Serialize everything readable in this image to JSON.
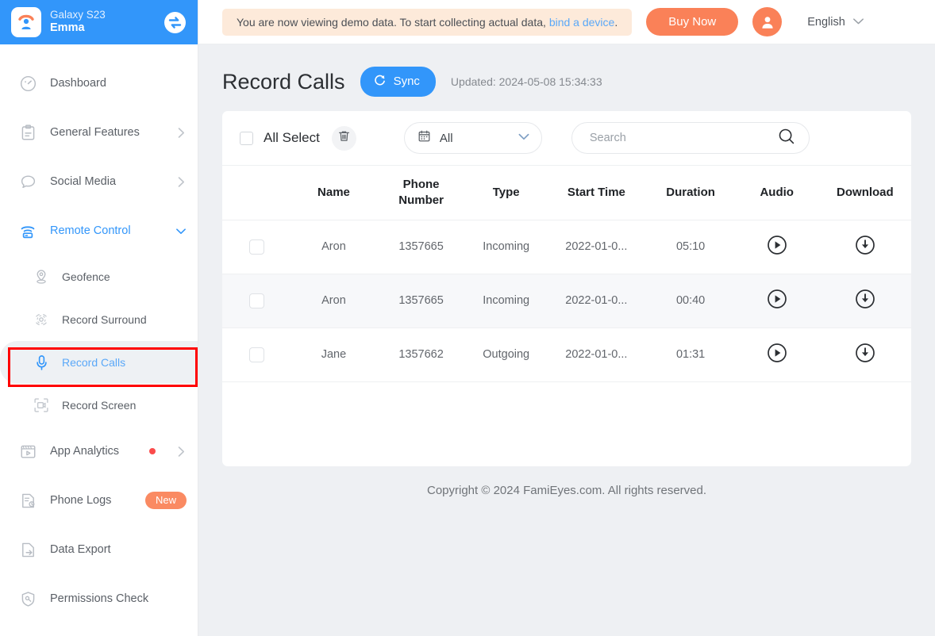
{
  "sidebar": {
    "device": {
      "model": "Galaxy S23",
      "user": "Emma",
      "switch_icon": "swap-device-icon",
      "logo_icon": "famieyes-logo-icon"
    },
    "items": [
      {
        "label": "Dashboard",
        "icon": "dashboard-gauge-icon",
        "level": 0,
        "state": "normal"
      },
      {
        "label": "General Features",
        "icon": "clipboard-icon",
        "level": 0,
        "state": "normal",
        "chevron": "chevron-right"
      },
      {
        "label": "Social Media",
        "icon": "chat-bubble-icon",
        "level": 0,
        "state": "normal",
        "chevron": "chevron-right"
      },
      {
        "label": "Remote Control",
        "icon": "wifi-remote-icon",
        "level": 0,
        "state": "expanded",
        "chevron": "chevron-down"
      },
      {
        "label": "Geofence",
        "icon": "location-pin-icon",
        "level": 1,
        "state": "normal"
      },
      {
        "label": "Record Surround",
        "icon": "surround-audio-icon",
        "level": 1,
        "state": "normal"
      },
      {
        "label": "Record Calls",
        "icon": "microphone-icon",
        "level": 1,
        "state": "selected"
      },
      {
        "label": "Record Screen",
        "icon": "screen-record-icon",
        "level": 1,
        "state": "normal"
      },
      {
        "label": "App Analytics",
        "icon": "app-analytics-icon",
        "level": 0,
        "state": "normal",
        "chevron": "chevron-right",
        "dot": true
      },
      {
        "label": "Phone Logs",
        "icon": "phone-logs-icon",
        "level": 0,
        "state": "normal",
        "badge": "New"
      },
      {
        "label": "Data Export",
        "icon": "data-export-icon",
        "level": 0,
        "state": "normal"
      },
      {
        "label": "Permissions Check",
        "icon": "shield-key-icon",
        "level": 0,
        "state": "normal"
      }
    ],
    "highlight_target": "Record Calls"
  },
  "topbar": {
    "banner_text_before": "You are now viewing demo data. To start collecting actual data, ",
    "banner_link": "bind a device",
    "banner_text_after": ".",
    "buy_label": "Buy Now",
    "avatar_icon": "user-avatar-icon",
    "language": "English",
    "language_chevron": "chevron-down-icon"
  },
  "page": {
    "title": "Record Calls",
    "sync_label": "Sync",
    "sync_icon": "refresh-icon",
    "updated": "Updated: 2024-05-08 15:34:33"
  },
  "toolbar": {
    "all_select_label": "All Select",
    "all_select_checked": false,
    "delete_icon": "trash-icon",
    "filter_icon": "calendar-icon",
    "filter_value": "All",
    "filter_chevron": "chevron-down-icon",
    "search_placeholder": "Search",
    "search_value": "",
    "search_icon": "search-icon"
  },
  "table": {
    "columns": [
      "",
      "Name",
      "Phone\nNumber",
      "Type",
      "Start Time",
      "Duration",
      "Audio",
      "Download"
    ],
    "headers": {
      "name": "Name",
      "phone_line1": "Phone",
      "phone_line2": "Number",
      "type": "Type",
      "start_time": "Start Time",
      "duration": "Duration",
      "audio": "Audio",
      "download": "Download"
    },
    "rows": [
      {
        "checked": false,
        "name": "Aron",
        "phone": "1357665",
        "type": "Incoming",
        "start_time": "2022-01-0...",
        "duration": "05:10",
        "audio_icon": "play-circle-icon",
        "download_icon": "download-circle-icon"
      },
      {
        "checked": false,
        "name": "Aron",
        "phone": "1357665",
        "type": "Incoming",
        "start_time": "2022-01-0...",
        "duration": "00:40",
        "audio_icon": "play-circle-icon",
        "download_icon": "download-circle-icon"
      },
      {
        "checked": false,
        "name": "Jane",
        "phone": "1357662",
        "type": "Outgoing",
        "start_time": "2022-01-0...",
        "duration": "01:31",
        "audio_icon": "play-circle-icon",
        "download_icon": "download-circle-icon"
      }
    ]
  },
  "footer": {
    "copyright": "Copyright © 2024 FamiEyes.com. All rights reserved."
  },
  "colors": {
    "brand_blue": "#3296fa",
    "accent_orange": "#fa8158",
    "banner_bg": "#fdeada",
    "highlight_red": "#ff0000",
    "page_bg": "#eef0f3"
  }
}
